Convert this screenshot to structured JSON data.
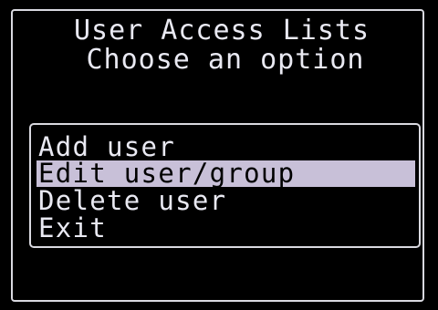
{
  "title": {
    "line1": "User Access Lists",
    "line2": "Choose an option"
  },
  "menu": {
    "selected_index": 1,
    "items": [
      {
        "label": "Add user"
      },
      {
        "label": "Edit user/group"
      },
      {
        "label": "Delete user"
      },
      {
        "label": "Exit"
      }
    ]
  },
  "colors": {
    "background": "#000000",
    "text": "#e9e9f2",
    "border": "#d9d9e0",
    "selection": "#c8c0d8"
  }
}
